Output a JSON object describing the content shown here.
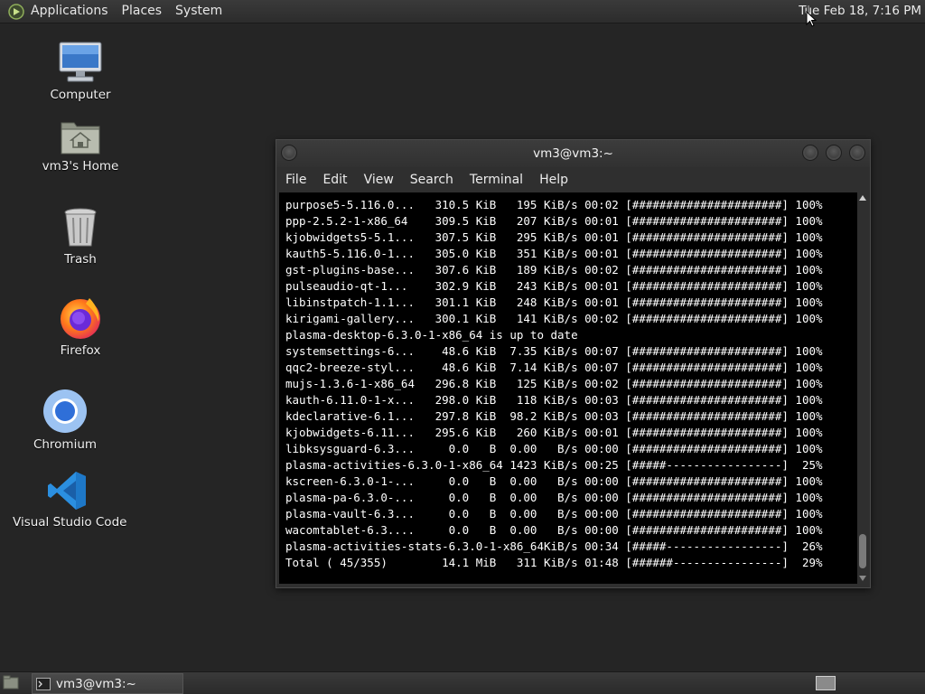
{
  "top_panel": {
    "menus": [
      "Applications",
      "Places",
      "System"
    ],
    "clock": "Tue Feb 18,  7:16 PM"
  },
  "desktop_icons": [
    {
      "label": "Computer",
      "icon": "computer-icon"
    },
    {
      "label": "vm3's Home",
      "icon": "home-folder-icon"
    },
    {
      "label": "Trash",
      "icon": "trash-icon"
    },
    {
      "label": "Firefox",
      "icon": "firefox-icon"
    },
    {
      "label": "Chromium",
      "icon": "chromium-icon"
    },
    {
      "label": "Visual Studio Code",
      "icon": "vscode-icon"
    }
  ],
  "terminal": {
    "title": "vm3@vm3:~",
    "menu": [
      "File",
      "Edit",
      "View",
      "Search",
      "Terminal",
      "Help"
    ],
    "lines": [
      "purpose5-5.116.0...   310.5 KiB   195 KiB/s 00:02 [######################] 100%",
      "ppp-2.5.2-1-x86_64    309.5 KiB   207 KiB/s 00:01 [######################] 100%",
      "kjobwidgets5-5.1...   307.5 KiB   295 KiB/s 00:01 [######################] 100%",
      "kauth5-5.116.0-1...   305.0 KiB   351 KiB/s 00:01 [######################] 100%",
      "gst-plugins-base...   307.6 KiB   189 KiB/s 00:02 [######################] 100%",
      "pulseaudio-qt-1...    302.9 KiB   243 KiB/s 00:01 [######################] 100%",
      "libinstpatch-1.1...   301.1 KiB   248 KiB/s 00:01 [######################] 100%",
      "kirigami-gallery...   300.1 KiB   141 KiB/s 00:02 [######################] 100%",
      "plasma-desktop-6.3.0-1-x86_64 is up to date",
      "systemsettings-6...    48.6 KiB  7.35 KiB/s 00:07 [######################] 100%",
      "qqc2-breeze-styl...    48.6 KiB  7.14 KiB/s 00:07 [######################] 100%",
      "mujs-1.3.6-1-x86_64   296.8 KiB   125 KiB/s 00:02 [######################] 100%",
      "kauth-6.11.0-1-x...   298.0 KiB   118 KiB/s 00:03 [######################] 100%",
      "kdeclarative-6.1...   297.8 KiB  98.2 KiB/s 00:03 [######################] 100%",
      "kjobwidgets-6.11...   295.6 KiB   260 KiB/s 00:01 [######################] 100%",
      "libksysguard-6.3...     0.0   B  0.00   B/s 00:00 [######################] 100%",
      "plasma-activities-6.3.0-1-x86_64 1423 KiB/s 00:25 [#####-----------------]  25%",
      "kscreen-6.3.0-1-...     0.0   B  0.00   B/s 00:00 [######################] 100%",
      "plasma-pa-6.3.0-...     0.0   B  0.00   B/s 00:00 [######################] 100%",
      "plasma-vault-6.3...     0.0   B  0.00   B/s 00:00 [######################] 100%",
      "wacomtablet-6.3....     0.0   B  0.00   B/s 00:00 [######################] 100%",
      "plasma-activities-stats-6.3.0-1-x86_64KiB/s 00:34 [#####-----------------]  26%",
      "Total ( 45/355)        14.1 MiB   311 KiB/s 01:48 [######----------------]  29%"
    ]
  },
  "taskbar": {
    "window_button": "vm3@vm3:~"
  }
}
